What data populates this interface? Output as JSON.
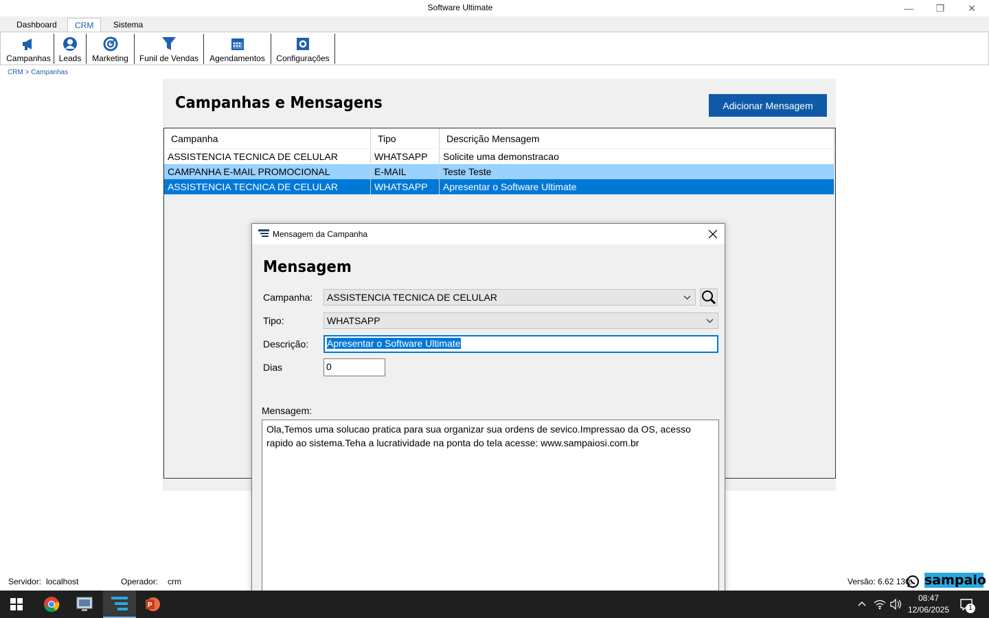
{
  "window": {
    "title": "Software Ultimate",
    "minimize_glyph": "—",
    "restore_glyph": "❐",
    "close_glyph": "✕"
  },
  "ribbon": {
    "tabs": [
      {
        "label": "Dashboard",
        "active": false
      },
      {
        "label": "CRM",
        "active": true
      },
      {
        "label": "Sistema",
        "active": false
      }
    ],
    "buttons": [
      {
        "label": "Campanhas",
        "icon": "megaphone-icon"
      },
      {
        "label": "Leads",
        "icon": "user-icon"
      },
      {
        "label": "Marketing",
        "icon": "target-icon"
      },
      {
        "label": "Funil de Vendas",
        "icon": "funnel-icon"
      },
      {
        "label": "Agendamentos",
        "icon": "calendar-icon"
      },
      {
        "label": "Configurações",
        "icon": "gear-icon"
      }
    ]
  },
  "breadcrumb": "CRM > Campanhas",
  "page": {
    "title": "Campanhas e Mensagens",
    "add_button": "Adicionar Mensagem"
  },
  "grid": {
    "columns": [
      "Campanha",
      "Tipo",
      "Descrição Mensagem"
    ],
    "rows": [
      {
        "campanha": "ASSISTENCIA TECNICA DE CELULAR",
        "tipo": "WHATSAPP",
        "descricao": "Solicite uma demonstracao",
        "state": "normal"
      },
      {
        "campanha": "CAMPANHA E-MAIL PROMOCIONAL",
        "tipo": "E-MAIL",
        "descricao": "Teste Teste",
        "state": "hover"
      },
      {
        "campanha": "ASSISTENCIA TECNICA DE CELULAR",
        "tipo": "WHATSAPP",
        "descricao": "Apresentar o Software Ultimate",
        "state": "selected"
      }
    ]
  },
  "dialog": {
    "title": "Mensagem da Campanha",
    "heading": "Mensagem",
    "campanha_label": "Campanha:",
    "campanha_value": "ASSISTENCIA TECNICA DE CELULAR",
    "tipo_label": "Tipo:",
    "tipo_value": "WHATSAPP",
    "descricao_label": "Descrição:",
    "descricao_value": "Apresentar o Software Ultimate",
    "dias_label": "Dias",
    "dias_value": "0",
    "mensagem_label": "Mensagem:",
    "mensagem_value": "Ola,Temos uma solucao pratica para sua organizar sua ordens de sevico.Impressao da OS, acesso rapido ao sistema.Teha a lucratividade na ponta do tela acesse: www.sampaiosi.com.br"
  },
  "status": {
    "servidor_label": "Servidor:",
    "servidor_value": "localhost",
    "operador_label": "Operador:",
    "operador_value": "crm",
    "versao": "Versão: 6.62 130:",
    "brand": "sampaio"
  },
  "taskbar": {
    "time": "08:47",
    "date": "12/06/2025",
    "notification_count": "1"
  },
  "colors": {
    "accent": "#0e5aa7",
    "row_hover": "#99d1ff",
    "row_selected": "#0078d7",
    "text_selection": "#0078d7",
    "taskbar": "#1f1f1f",
    "brand_bg": "#29a8e0"
  }
}
